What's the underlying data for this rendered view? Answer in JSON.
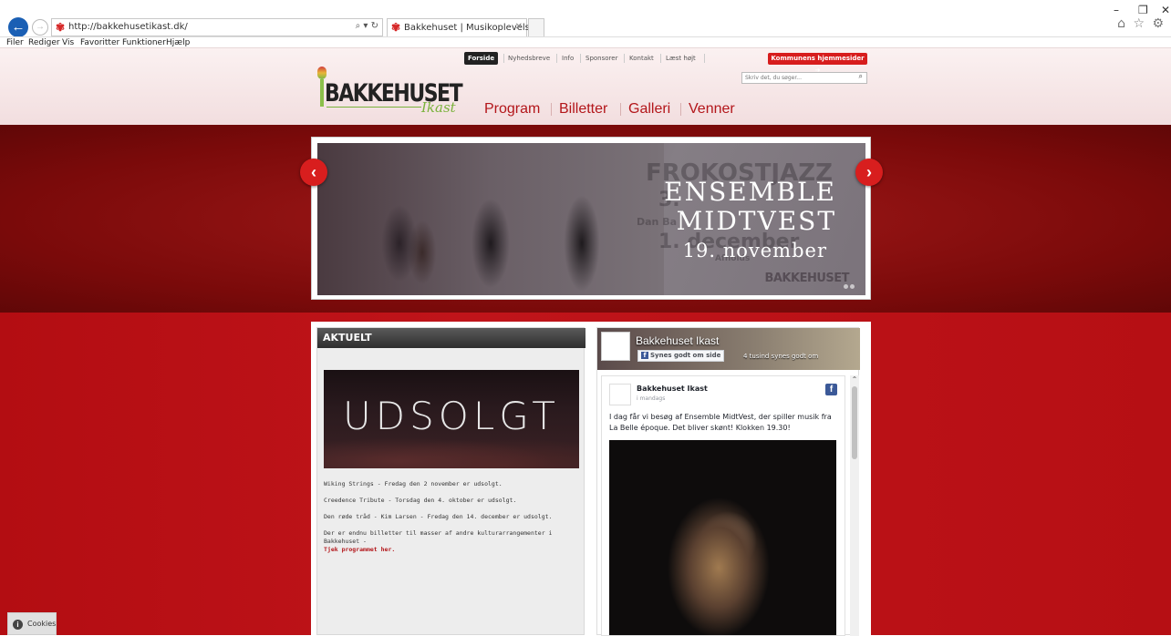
{
  "browser": {
    "url": "http://bakkehusetikast.dk/",
    "address_tools": "⌕ ▾ ↻",
    "tab_title": "Bakkehuset | Musikoplevelser",
    "tab_close": "✕",
    "window_controls": {
      "minimize": "–",
      "restore": "❐",
      "close": "✕"
    },
    "corner_icons": "⌂ ☆ ⚙",
    "menu": [
      "Filer",
      "Rediger",
      "Vis",
      "Favoritter",
      "Funktioner",
      "Hjælp"
    ]
  },
  "site": {
    "top_nav": [
      "Forside",
      "Nyhedsbreve",
      "Info",
      "Sponsorer",
      "Kontakt",
      "Læst højt"
    ],
    "kommune_button": "Kommunens hjemmesider ➔",
    "search_placeholder": "Skriv det, du søger...",
    "search_icon": "⌕",
    "logo_name": "BAKKEHUSET",
    "logo_sub": "Ikast",
    "main_nav": [
      "Program",
      "Billetter",
      "Galleri",
      "Venner"
    ]
  },
  "slider": {
    "arrow_prev": "‹",
    "arrow_next": "›",
    "ghost_line1": "FROKOSTJAZZ",
    "ghost_line2": "3. ",
    "ghost_line3": "Dan Ba",
    "ghost_line4": "1. december",
    "ghost_line5": "Afholds",
    "headline_line1": "ENSEMBLE",
    "headline_line2": "MIDTVEST",
    "date": "19. november",
    "brand": "BAKKEHUSET"
  },
  "aktuelt": {
    "title": "AKTUELT",
    "image_text": "UDSOLGT",
    "items": [
      "Wiking Strings - Fredag den 2 november er udsolgt.",
      "Creedence Tribute - Torsdag den 4. oktober er udsolgt.",
      "Den røde tråd - Kim Larsen - Fredag den 14. december er udsolgt."
    ],
    "more_text": "Der er endnu billetter til masser af andre kulturarrangementer i Bakkehuset -",
    "more_link": "Tjek programmet her."
  },
  "facebook": {
    "page_name": "Bakkehuset Ikast",
    "like_button": "Synes godt om side",
    "like_count": "4 tusind synes godt om",
    "post_author": "Bakkehuset Ikast",
    "post_time": "i mandags",
    "post_text": "I dag får vi besøg af Ensemble MidtVest, der spiller musik fra La Belle époque. Det bliver skønt! Klokken 19.30!",
    "fb_glyph": "f",
    "scroll_up": "⌃"
  },
  "cookies": {
    "label": "Cookies",
    "icon": "i"
  }
}
